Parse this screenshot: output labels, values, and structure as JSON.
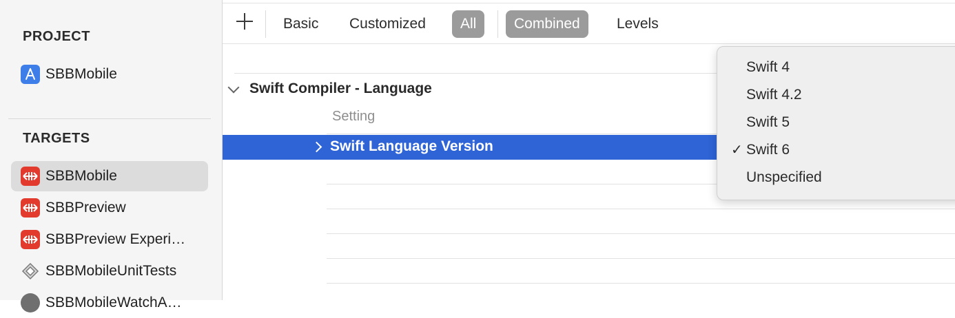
{
  "sidebar": {
    "project_header": "PROJECT",
    "project": {
      "label": "SBBMobile",
      "icon": "app-store-icon"
    },
    "targets_header": "TARGETS",
    "targets": [
      {
        "label": "SBBMobile",
        "icon": "sbb-logo-icon",
        "selected": true
      },
      {
        "label": "SBBPreview",
        "icon": "sbb-logo-icon",
        "selected": false
      },
      {
        "label": "SBBPreview Experi…",
        "icon": "sbb-logo-icon",
        "selected": false
      },
      {
        "label": "SBBMobileUnitTests",
        "icon": "unit-tests-icon",
        "selected": false
      },
      {
        "label": "SBBMobileWatchA…",
        "icon": "watch-app-icon",
        "selected": false
      }
    ]
  },
  "tabbar": {
    "add_icon": "plus-icon",
    "basic": "Basic",
    "customized": "Customized",
    "all": "All",
    "combined": "Combined",
    "levels": "Levels",
    "active_filter": "All",
    "active_view": "Combined"
  },
  "settings": {
    "group_title": "Swift Compiler - Language",
    "column_header": "Setting",
    "selected_setting": "Swift Language Version"
  },
  "popup_menu": {
    "items": [
      {
        "label": "Swift 4",
        "checked": false
      },
      {
        "label": "Swift 4.2",
        "checked": false
      },
      {
        "label": "Swift 5",
        "checked": false
      },
      {
        "label": "Swift 6",
        "checked": true
      },
      {
        "label": "Unspecified",
        "checked": false
      }
    ],
    "check_mark": "✓"
  },
  "colors": {
    "selection_blue": "#2f64d6",
    "sbb_red": "#e23b2e",
    "project_blue": "#3d7ee8",
    "active_tab_gray": "#9b9b9b"
  }
}
